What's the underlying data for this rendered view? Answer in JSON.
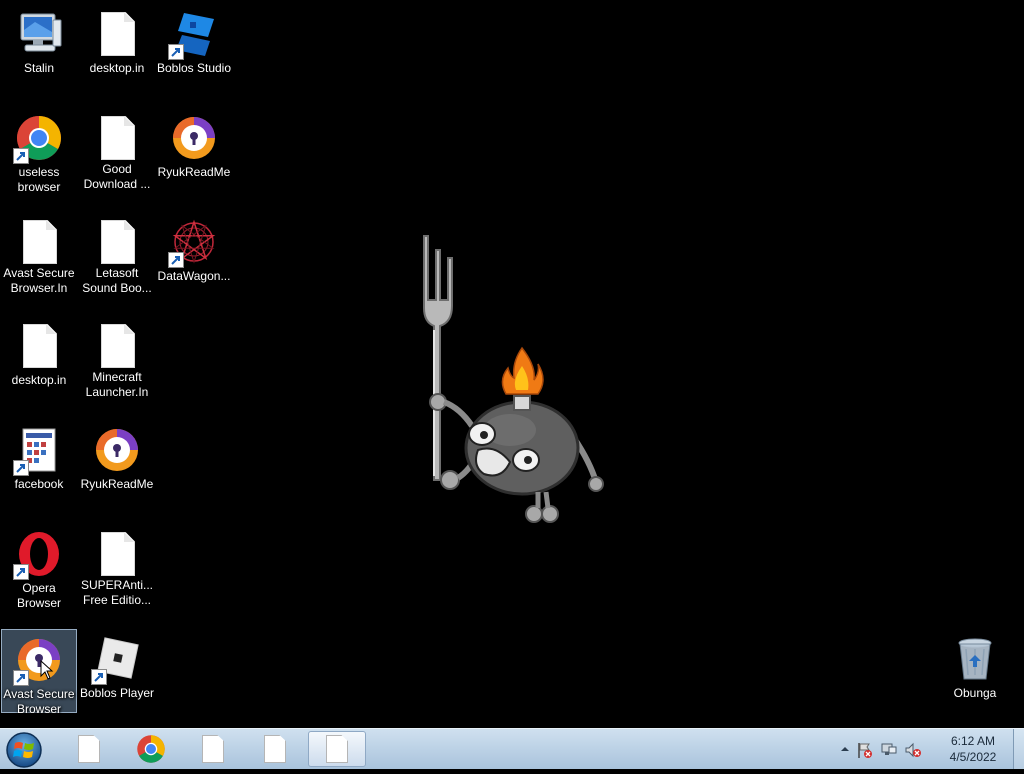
{
  "desktop": {
    "icons": [
      {
        "label": "Stalin"
      },
      {
        "label": "desktop.in"
      },
      {
        "label": "Boblos Studio"
      },
      {
        "label": "useless browser"
      },
      {
        "label": "Good Download ..."
      },
      {
        "label": "RyukReadMe"
      },
      {
        "label": "Avast Secure Browser.In"
      },
      {
        "label": "Letasoft Sound Boo..."
      },
      {
        "label": "DataWagon..."
      },
      {
        "label": "desktop.in"
      },
      {
        "label": "Minecraft Launcher.In"
      },
      {
        "label": "facebook"
      },
      {
        "label": "RyukReadMe"
      },
      {
        "label": "Opera Browser"
      },
      {
        "label": "SUPERAnti... Free Editio..."
      },
      {
        "label": "Avast Secure Browser"
      },
      {
        "label": "Boblos Player"
      },
      {
        "label": "Obunga"
      }
    ]
  },
  "taskbar": {
    "clock_time": "6:12 AM",
    "clock_date": "4/5/2022"
  },
  "colors": {
    "desktop_bg": "#000000",
    "taskbar": "#b8cfe4",
    "selection": "#96bee6"
  }
}
